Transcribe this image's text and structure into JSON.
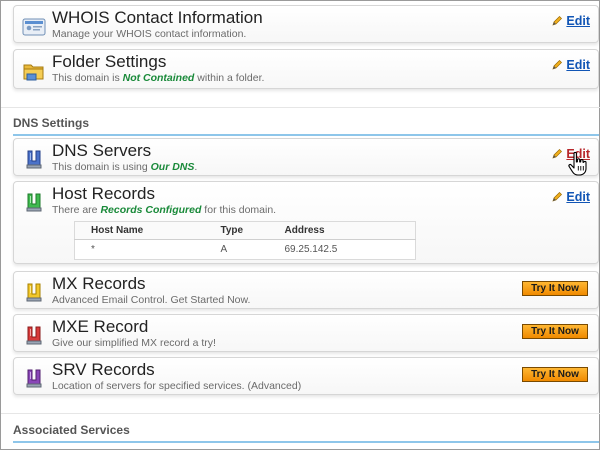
{
  "cards": {
    "whois": {
      "title": "WHOIS Contact Information",
      "desc": "Manage your WHOIS contact information.",
      "edit": "Edit"
    },
    "folder": {
      "title": "Folder Settings",
      "desc_pre": "This domain is ",
      "desc_hl": "Not Contained",
      "desc_post": " within a folder.",
      "edit": "Edit"
    },
    "dns_servers": {
      "title": "DNS Servers",
      "desc_pre": "This domain is using ",
      "desc_hl": "Our DNS",
      "desc_post": ".",
      "edit": "Edit"
    },
    "host_records": {
      "title": "Host Records",
      "desc_pre": "There are ",
      "desc_hl": "Records Configured",
      "desc_post": " for this domain.",
      "edit": "Edit",
      "table": {
        "headers": [
          "Host Name",
          "Type",
          "Address"
        ],
        "rows": [
          [
            "*",
            "A",
            "69.25.142.5"
          ]
        ]
      }
    },
    "mx": {
      "title": "MX Records",
      "desc": "Advanced Email Control. Get Started Now.",
      "button": "Try It Now"
    },
    "mxe": {
      "title": "MXE Record",
      "desc": "Give our simplified MX record a try!",
      "button": "Try It Now"
    },
    "srv": {
      "title": "SRV Records",
      "desc": "Location of servers for specified services. (Advanced)",
      "button": "Try It Now"
    }
  },
  "sections": {
    "dns": "DNS Settings",
    "associated": "Associated Services"
  },
  "colors": {
    "link": "#1155b5",
    "link_hover": "#b8272b",
    "highlight": "#1a8a3a",
    "accent_line": "#8ec6ea",
    "button_orange": "#f39a12"
  },
  "icons": {
    "whois": "contact-card-icon",
    "folder": "folder-icon",
    "dns_servers": "dns-server-blue-icon",
    "host_records": "dns-server-green-icon",
    "mx": "dns-server-yellow-icon",
    "mxe": "dns-server-red-icon",
    "srv": "dns-server-purple-icon",
    "edit": "pencil-icon",
    "cursor": "hand-pointer-icon"
  }
}
